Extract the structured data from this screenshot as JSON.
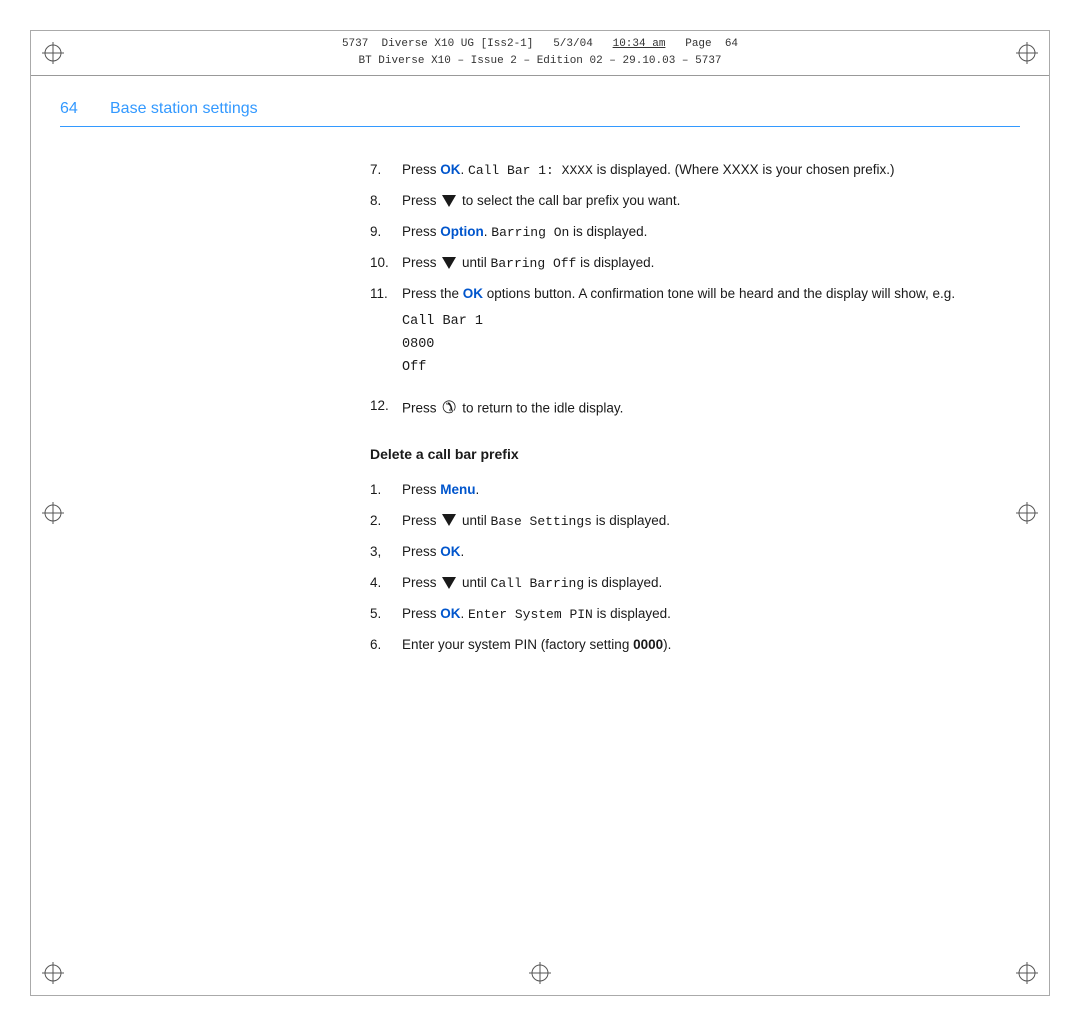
{
  "header": {
    "line1": "5737  Diverse X10 UG [Iss2-1]   5/3/04   10:34 am   Page  64",
    "line2": "BT Diverse X10 – Issue 2 – Edition 02 – 29.10.03 – 5737"
  },
  "page": {
    "number": "64",
    "title": "Base station settings"
  },
  "steps_continued": [
    {
      "num": "7.",
      "content": "Press <OK>. <mono>Call Bar 1: XXXX</mono> is displayed. (Where XXXX is your chosen prefix.)"
    },
    {
      "num": "8.",
      "content": "Press <down> to select the call bar prefix you want."
    },
    {
      "num": "9.",
      "content": "Press <Option>. <mono>Barring On</mono> is displayed."
    },
    {
      "num": "10.",
      "content": "Press <down> until <mono>Barring Off</mono> is displayed."
    },
    {
      "num": "11.",
      "content": "Press the <OK> options button. A confirmation tone will be heard and the display will show, e.g."
    },
    {
      "num": "12.",
      "content": "Press <phone> to return to the idle display."
    }
  ],
  "display_example": {
    "line1": "Call Bar 1",
    "line2": "0800",
    "line3": "Off"
  },
  "section_delete": {
    "heading": "Delete a call bar prefix",
    "steps": [
      {
        "num": "1.",
        "content": "Press <Menu>."
      },
      {
        "num": "2.",
        "content": "Press <down> until <mono>Base Settings</mono> is displayed."
      },
      {
        "num": "3,",
        "content": "Press <OK>."
      },
      {
        "num": "4.",
        "content": "Press <down> until <mono>Call Barring</mono> is displayed."
      },
      {
        "num": "5.",
        "content": "Press <OK>. <mono>Enter System PIN</mono> is displayed."
      },
      {
        "num": "6.",
        "content": "Enter your system PIN (factory setting <bold>0000</bold>)."
      }
    ]
  },
  "labels": {
    "ok": "OK",
    "option": "Option",
    "menu": "Menu",
    "pin_default": "0000"
  }
}
